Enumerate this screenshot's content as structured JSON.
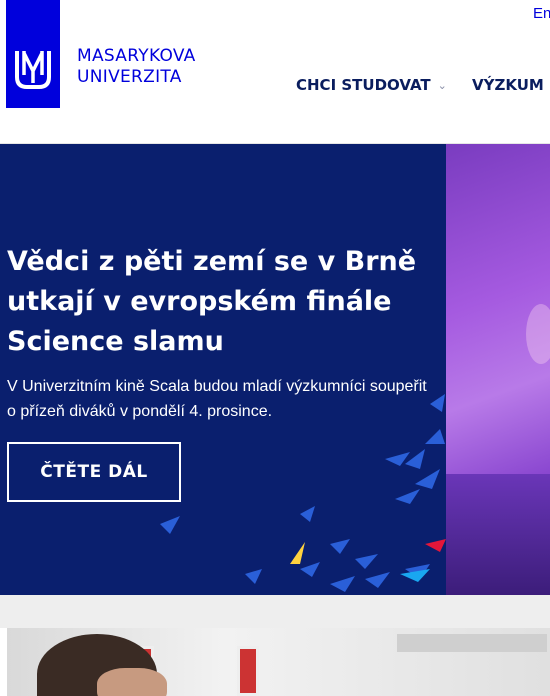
{
  "header": {
    "lang_switch": "En",
    "brand_line1": "MASARYKOVA",
    "brand_line2": "UNIVERZITA",
    "nav": [
      {
        "label": "CHCI STUDOVAT"
      },
      {
        "label": "VÝZKUM"
      }
    ]
  },
  "hero": {
    "title": "Vědci z pěti zemí se v Brně utkají v evropském finále Science slamu",
    "text": "V Univerzitním kině Scala budou mladí výzkumníci soupeřit o přízeň diváků v pondělí 4. prosince.",
    "button": "ČTĚTE DÁL"
  },
  "colors": {
    "brand_blue": "#0000dc",
    "hero_bg": "#0a1f6e",
    "nav_text": "#0a1d5e"
  },
  "icons": {
    "logo": "mu-logo-icon",
    "nav_chevron": "chevron-down-icon"
  }
}
